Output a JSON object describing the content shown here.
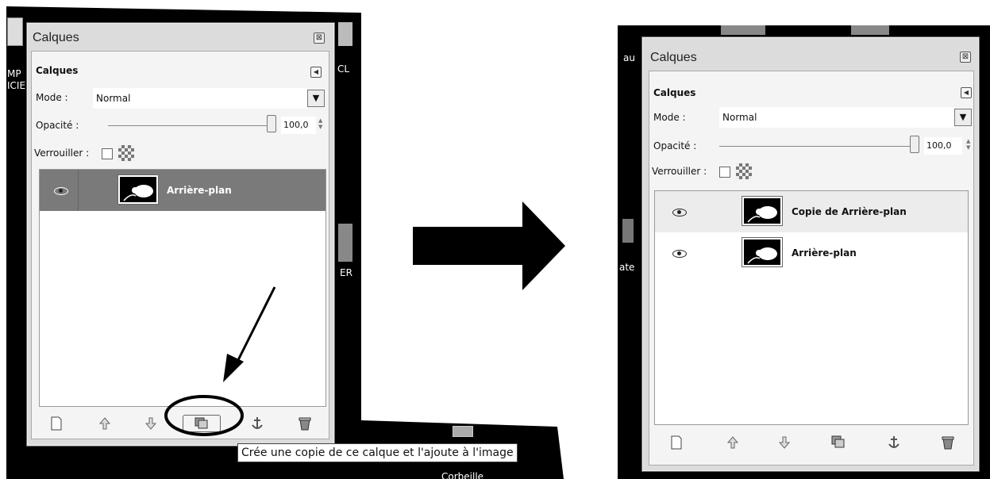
{
  "before": {
    "desktop_labels": [
      "MP",
      "ICIE",
      "CL",
      "ER",
      "Corbeille"
    ],
    "window": {
      "title": "Calques",
      "close_glyph": "⊠",
      "section_title": "Calques",
      "mode_label": "Mode :",
      "mode_value": "Normal",
      "opacity_label": "Opacité :",
      "opacity_value": "100,0",
      "lock_label": "Verrouiller :",
      "layers": [
        {
          "name": "Arrière-plan",
          "selected": true
        }
      ]
    },
    "tooltip": "Crée une copie de ce calque et l'ajoute à l'image"
  },
  "after": {
    "desktop_labels": [
      "au",
      "ate"
    ],
    "window": {
      "title": "Calques",
      "close_glyph": "⊠",
      "section_title": "Calques",
      "mode_label": "Mode :",
      "mode_value": "Normal",
      "opacity_label": "Opacité :",
      "opacity_value": "100,0",
      "lock_label": "Verrouiller :",
      "layers": [
        {
          "name": "Copie de Arrière-plan",
          "selected": true
        },
        {
          "name": "Arrière-plan",
          "selected": false
        }
      ]
    }
  },
  "toolbar_icons": [
    "new-layer-icon",
    "raise-layer-icon",
    "lower-layer-icon",
    "duplicate-layer-icon",
    "anchor-layer-icon",
    "delete-layer-icon"
  ],
  "colors": {
    "desktop": "#000000",
    "panel": "#dcdcdc",
    "selected_row_before": "#7a7a7a",
    "selected_row_after": "#ececec",
    "annotation": "#000000"
  }
}
